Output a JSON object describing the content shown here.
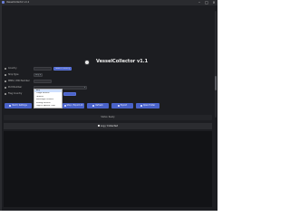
{
  "window": {
    "title": "VesselCollector v1.1",
    "controls": [
      "–",
      "□",
      "×"
    ]
  },
  "header": {
    "logo_icon": "vessel-logo-icon",
    "title": "VesselCollector v1.1"
  },
  "form": {
    "rows": [
      {
        "label": "Country",
        "value": "",
        "value2": "Select Country"
      },
      {
        "label": "Ship Type",
        "value": "Any"
      },
      {
        "label": "MMSI / IMO Number",
        "value": ""
      },
      {
        "label": "Port Number",
        "value": ""
      },
      {
        "label": "Flag Country",
        "value": ""
      }
    ]
  },
  "dropdown": {
    "items": [
      "Any",
      "Cargo Vessels",
      "Tankers",
      "Passenger Vessels",
      "Fishing Vessels",
      "Tugs & Special Craft"
    ],
    "selected_index": 0
  },
  "buttons": [
    {
      "label": "Start / Settings",
      "icon": "play-icon"
    },
    {
      "label": "Start Collection",
      "icon": "download-icon"
    },
    {
      "label": "Stop / Export All",
      "icon": "stop-icon"
    },
    {
      "label": "Refresh",
      "icon": "refresh-icon"
    },
    {
      "label": "Export",
      "icon": "export-icon"
    },
    {
      "label": "Open Folder",
      "icon": "folder-icon"
    }
  ],
  "status": {
    "text": "Status: Ready"
  },
  "log": {
    "title": "Log / Collected",
    "icon": "list-icon"
  },
  "colors": {
    "accent": "#4a63c9",
    "background": "#1c1d21"
  }
}
